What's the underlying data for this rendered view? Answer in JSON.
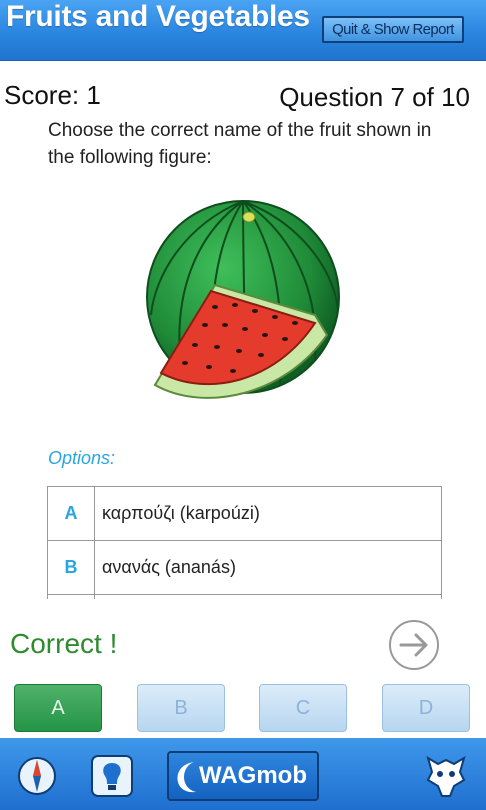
{
  "header": {
    "title": "Fruits and Vegetables",
    "quit_button": "Quit & Show Report"
  },
  "status": {
    "score": "Score: 1",
    "question_counter": "Question 7 of 10"
  },
  "question": {
    "text": "Choose the correct name of the fruit shown in the following figure:"
  },
  "options": {
    "label": "Options:",
    "items": [
      {
        "letter": "A",
        "text": "καρπούζι (karpoúzi)"
      },
      {
        "letter": "B",
        "text": "ανανάς (ananás)"
      }
    ]
  },
  "feedback": {
    "text": "Correct !"
  },
  "answer_buttons": [
    {
      "label": "A",
      "state": "selected"
    },
    {
      "label": "B",
      "state": "inactive"
    },
    {
      "label": "C",
      "state": "inactive"
    },
    {
      "label": "D",
      "state": "inactive"
    }
  ],
  "footer": {
    "brand": "WAGmob",
    "icons": [
      "compass-icon",
      "lightbulb-icon",
      "mascot-icon"
    ]
  },
  "colors": {
    "header_blue": "#2b86e0",
    "accent_cyan": "#2aa6de",
    "correct_green": "#2e8b2e",
    "selected_button": "#249447"
  }
}
